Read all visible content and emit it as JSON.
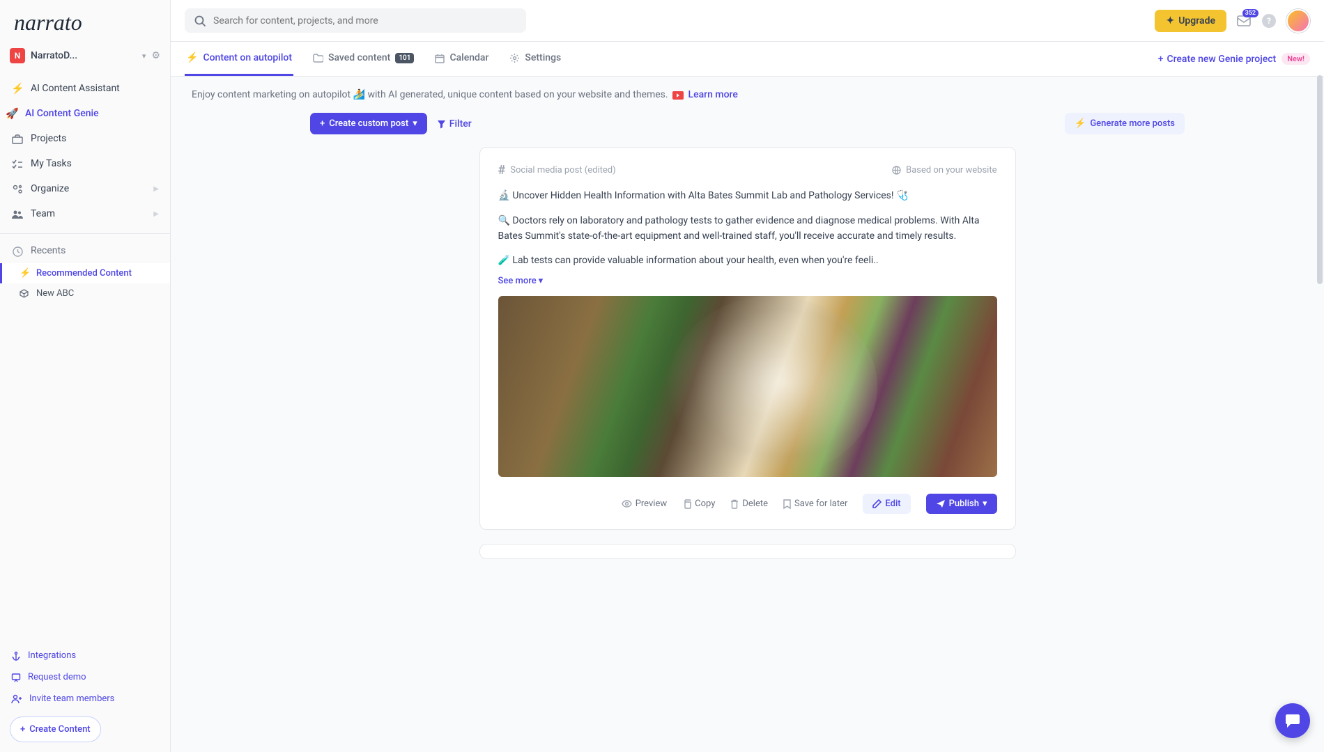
{
  "brand": "narrato",
  "workspace": {
    "badge": "N",
    "name": "NarratoD..."
  },
  "sidebar": {
    "items": [
      {
        "icon": "⚡",
        "label": "AI Content Assistant"
      },
      {
        "icon": "🚀",
        "label": "AI Content Genie"
      },
      {
        "icon": "briefcase",
        "label": "Projects"
      },
      {
        "icon": "checklist",
        "label": "My Tasks"
      },
      {
        "icon": "gear-people",
        "label": "Organize",
        "expand": true
      },
      {
        "icon": "team",
        "label": "Team",
        "expand": true
      }
    ],
    "recents": {
      "label": "Recents",
      "items": [
        {
          "icon": "⚡",
          "label": "Recommended Content",
          "active": true
        },
        {
          "icon": "cube",
          "label": "New ABC"
        }
      ]
    },
    "bottom": [
      {
        "icon": "anchor",
        "label": "Integrations"
      },
      {
        "icon": "presentation",
        "label": "Request demo"
      },
      {
        "icon": "user-plus",
        "label": "Invite team members"
      }
    ],
    "create": "Create Content"
  },
  "topbar": {
    "search_placeholder": "Search for content, projects, and more",
    "upgrade": "Upgrade",
    "badge_count": "352"
  },
  "tabs": {
    "items": [
      {
        "icon": "⚡",
        "label": "Content on autopilot",
        "active": true
      },
      {
        "icon": "folder",
        "label": "Saved content",
        "count": "101"
      },
      {
        "icon": "calendar",
        "label": "Calendar"
      },
      {
        "icon": "gear",
        "label": "Settings"
      }
    ],
    "create_project": "Create new Genie project",
    "new_label": "New!"
  },
  "intro": {
    "text_a": "Enjoy content marketing on autopilot 🏄 with AI generated, unique content based on your website and themes.",
    "learn_more": "Learn more"
  },
  "toolbar": {
    "custom_post": "Create custom post",
    "filter": "Filter",
    "generate_more": "Generate more posts"
  },
  "post": {
    "type_label": "Social media post (edited)",
    "source_label": "Based on your website",
    "p1": "🔬 Uncover Hidden Health Information with Alta Bates Summit Lab and Pathology Services! 🩺",
    "p2": "🔍 Doctors rely on laboratory and pathology tests to gather evidence and diagnose medical problems. With Alta Bates Summit's state-of-the-art equipment and well-trained staff, you'll receive accurate and timely results.",
    "p3": "🧪 Lab tests can provide valuable information about your health, even when you're feeli..",
    "see_more": "See more",
    "actions": {
      "preview": "Preview",
      "copy": "Copy",
      "delete": "Delete",
      "save": "Save for later",
      "edit": "Edit",
      "publish": "Publish"
    }
  }
}
